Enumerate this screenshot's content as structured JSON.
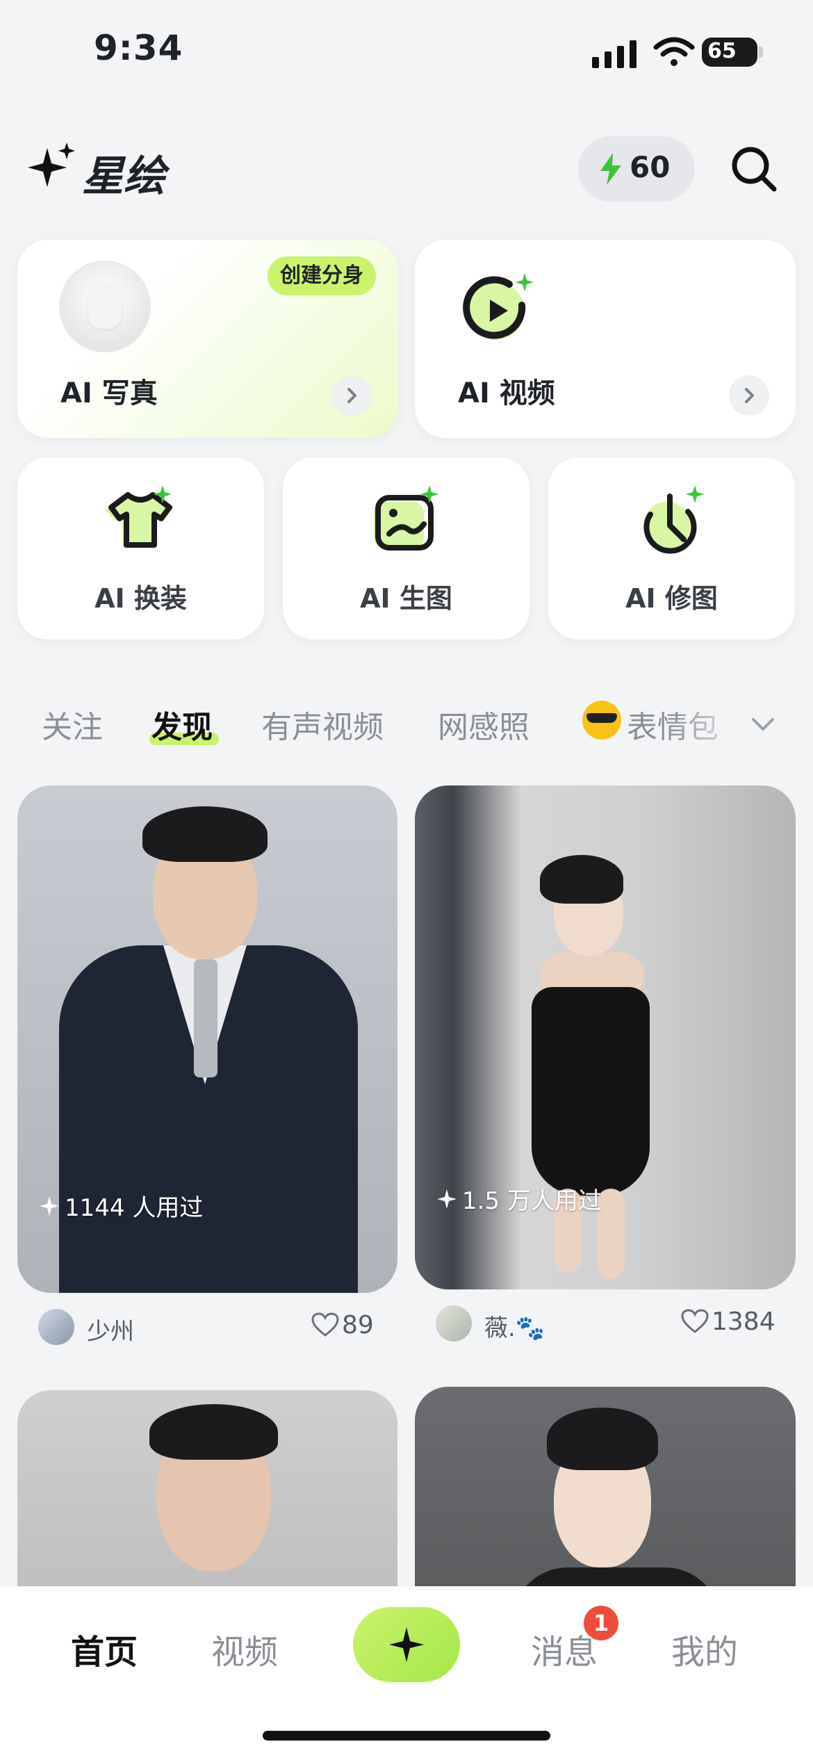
{
  "status_bar": {
    "time": "9:34",
    "battery": "65"
  },
  "header": {
    "app_name": "星绘",
    "credits": "60"
  },
  "features": {
    "portrait": {
      "label": "AI 写真",
      "badge": "创建分身"
    },
    "video": {
      "label": "AI 视频"
    },
    "outfit": {
      "label": "AI 换装"
    },
    "generate": {
      "label": "AI 生图"
    },
    "retouch": {
      "label": "AI 修图"
    }
  },
  "tabs": [
    "关注",
    "发现",
    "有声视频",
    "网感照",
    "表情包"
  ],
  "active_tab": "发现",
  "feed": [
    {
      "used": "1144 人用过",
      "author": "少州",
      "likes": "89"
    },
    {
      "used": "1.5 万人用过",
      "author": "薇.🐾",
      "likes": "1384"
    }
  ],
  "nav": {
    "home": "首页",
    "video": "视频",
    "messages": "消息",
    "mine": "我的",
    "messages_badge": "1"
  },
  "colors": {
    "accent": "#c9f36a",
    "badge_red": "#f04c3c",
    "text": "#1f2329",
    "muted": "#8a8f96"
  }
}
